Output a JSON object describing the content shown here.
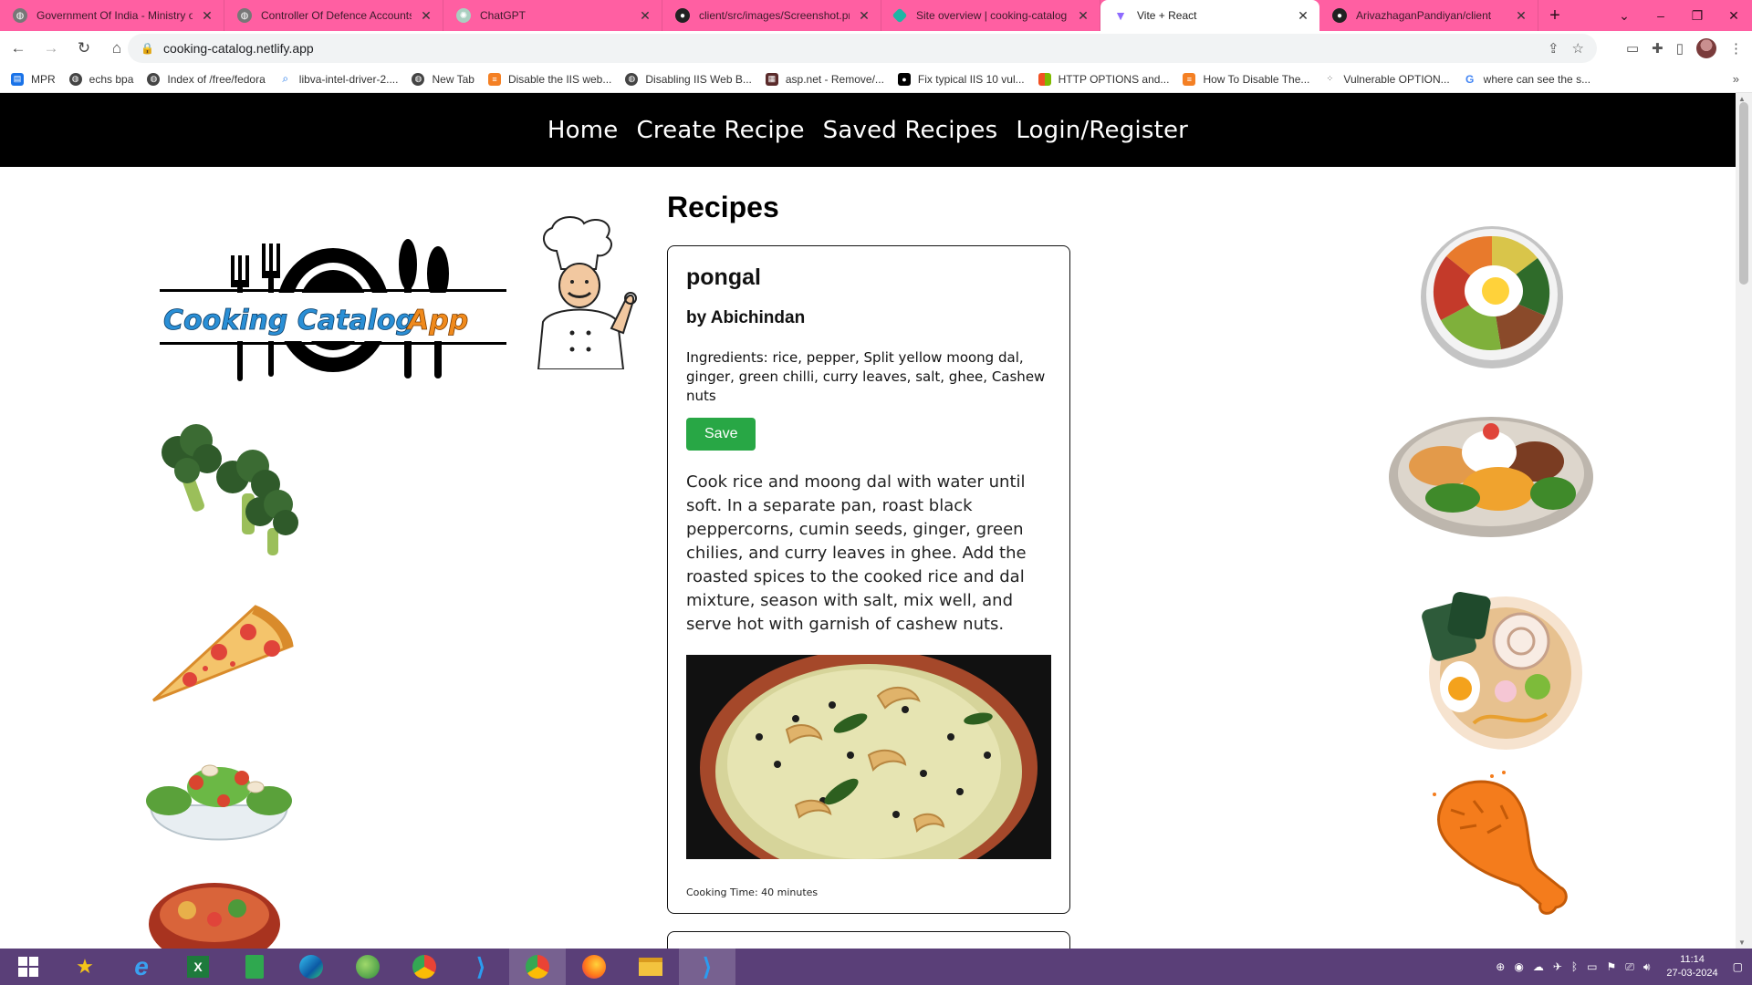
{
  "browser": {
    "tabs": [
      {
        "title": "Government Of India - Ministry o",
        "icon": "globe-icon",
        "active": false
      },
      {
        "title": "Controller Of Defence Accounts",
        "icon": "globe-icon",
        "active": false
      },
      {
        "title": "ChatGPT",
        "icon": "chatgpt-icon",
        "active": false
      },
      {
        "title": "client/src/images/Screenshot.pn",
        "icon": "github-icon",
        "active": false
      },
      {
        "title": "Site overview | cooking-catalog",
        "icon": "netlify-icon",
        "active": false
      },
      {
        "title": "Vite + React",
        "icon": "vite-icon",
        "active": true
      },
      {
        "title": "ArivazhaganPandiyan/client",
        "icon": "github-icon",
        "active": false
      }
    ],
    "url": "cooking-catalog.netlify.app",
    "bookmarks": [
      {
        "label": "MPR",
        "icon": "bookmark-icon"
      },
      {
        "label": "echs bpa",
        "icon": "globe-icon"
      },
      {
        "label": "Index of /free/fedora",
        "icon": "globe-icon"
      },
      {
        "label": "libva-intel-driver-2....",
        "icon": "search-icon"
      },
      {
        "label": "New Tab",
        "icon": "globe-icon"
      },
      {
        "label": "Disable the IIS web...",
        "icon": "stack-icon"
      },
      {
        "label": "Disabling IIS Web B...",
        "icon": "globe-icon"
      },
      {
        "label": "asp.net - Remove/...",
        "icon": "aspnet-icon"
      },
      {
        "label": "Fix typical IIS 10 vul...",
        "icon": "medium-icon"
      },
      {
        "label": "HTTP OPTIONS and...",
        "icon": "windows-icon"
      },
      {
        "label": "How To Disable The...",
        "icon": "stack-icon"
      },
      {
        "label": "Vulnerable OPTION...",
        "icon": "dots-icon"
      },
      {
        "label": "where can see the s...",
        "icon": "google-icon"
      }
    ]
  },
  "nav": {
    "home": "Home",
    "create": "Create Recipe",
    "saved": "Saved Recipes",
    "login": "Login/Register"
  },
  "logo": {
    "text_main": "Cooking Catalog",
    "text_accent": "App"
  },
  "page": {
    "heading": "Recipes"
  },
  "recipes": [
    {
      "name": "pongal",
      "author": "by Abichindan",
      "ingredients": "Ingredients: rice, pepper, Split yellow moong dal, ginger, green chilli, curry leaves, salt, ghee, Cashew nuts",
      "save_label": "Save",
      "instructions": "Cook rice and moong dal with water until soft. In a separate pan, roast black peppercorns, cumin seeds, ginger, green chilies, and curry leaves in ghee. Add the roasted spices to the cooked rice and dal mixture, season with salt, mix well, and serve hot with garnish of cashew nuts.",
      "cooking_time": "Cooking Time: 40 minutes"
    }
  ],
  "taskbar": {
    "time": "11:14",
    "date": "27-03-2024"
  },
  "colors": {
    "tabstrip": "#ff5fa2",
    "navbar": "#000000",
    "save_button": "#28a745",
    "taskbar": "#5a3f78",
    "logo_blue": "#2a8fd6",
    "logo_orange": "#f08a1c"
  }
}
